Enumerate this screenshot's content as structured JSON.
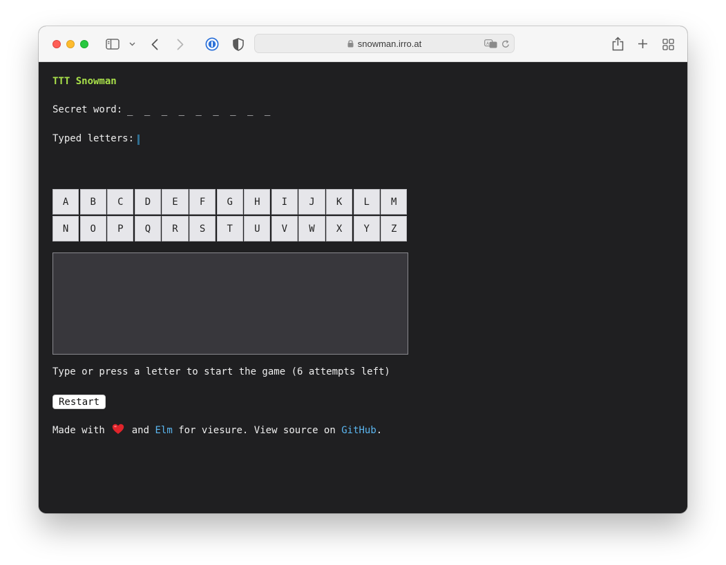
{
  "browser": {
    "url": "snowman.irro.at"
  },
  "page": {
    "title": "TTT Snowman",
    "secret_label": "Secret word:",
    "secret_value": "_ _ _ _ _ _ _ _ _",
    "typed_label": "Typed letters:",
    "keys": [
      "A",
      "B",
      "C",
      "D",
      "E",
      "F",
      "G",
      "H",
      "I",
      "J",
      "K",
      "L",
      "M",
      "N",
      "O",
      "P",
      "Q",
      "R",
      "S",
      "T",
      "U",
      "V",
      "W",
      "X",
      "Y",
      "Z"
    ],
    "status": "Type or press a letter to start the game (6 attempts left)",
    "restart_label": "Restart",
    "footer": {
      "made_with": "Made with",
      "heart_icon": "heart-icon",
      "and": "and",
      "elm_link": "Elm",
      "for_text": "for viesure. View source on",
      "github_link": "GitHub",
      "period": "."
    }
  },
  "colors": {
    "title": "#a8e04a",
    "link": "#5bb6f0",
    "background": "#1f1f21",
    "key_bg": "#e6e6ea",
    "drawing_bg": "#38373c",
    "cursor": "#2f6d8f",
    "heart": "#e0242b"
  }
}
